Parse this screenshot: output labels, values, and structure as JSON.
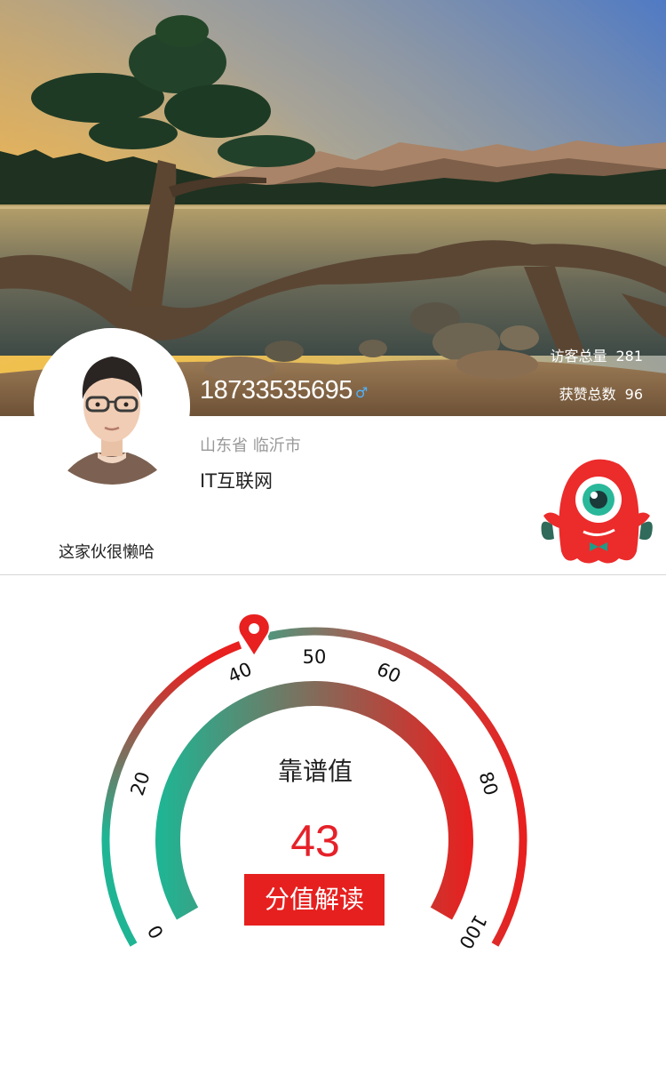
{
  "profile": {
    "phone": "18733535695",
    "gender_symbol": "♂",
    "location": "山东省 临沂市",
    "industry": "IT互联网",
    "bio": "这家伙很懒哈"
  },
  "stats": {
    "visitors_label": "访客总量",
    "visitors_value": "281",
    "likes_label": "获赞总数",
    "likes_value": "96"
  },
  "gauge": {
    "title": "靠谱值",
    "value": "43",
    "score": 43,
    "range": [
      0,
      100
    ],
    "tick_labels": [
      "0",
      "20",
      "40",
      "50",
      "60",
      "80",
      "100"
    ],
    "button_label": "分值解读",
    "colors": {
      "start": "#1fb594",
      "end": "#e8201f",
      "marker": "#e8201f"
    }
  },
  "icons": [
    "avatar",
    "male-icon",
    "mascot-icon",
    "location-marker-icon"
  ]
}
